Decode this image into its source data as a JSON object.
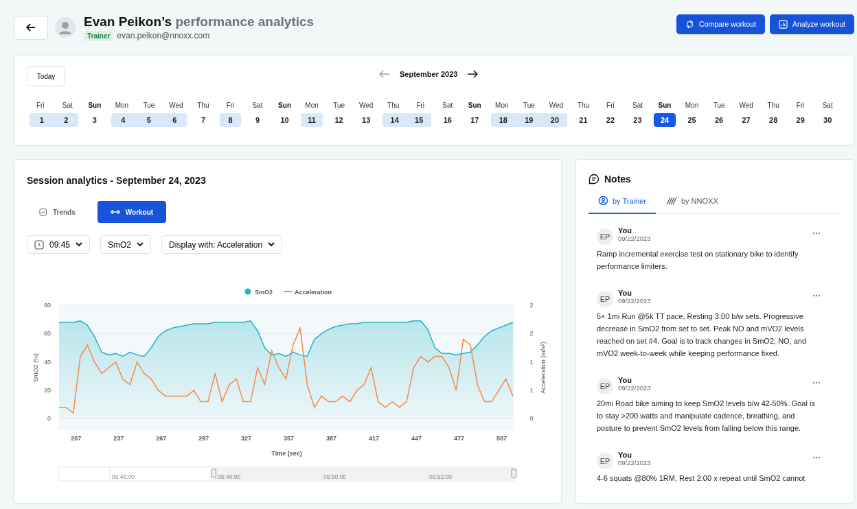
{
  "header": {
    "owner": "Evan Peikon’s",
    "title": "performance analytics",
    "role_badge": "Trainer",
    "email": "evan.peikon@nnoxx.com",
    "buttons": [
      {
        "label": "Compare workout",
        "kind": "compare"
      },
      {
        "label": "Analyze workout",
        "kind": "analyze"
      }
    ]
  },
  "calendar": {
    "today_button": "Today",
    "month": "September 2023",
    "days": [
      {
        "weekday": "Fri",
        "day": "1",
        "bold": false,
        "has_session": true,
        "selected": false
      },
      {
        "weekday": "Sat",
        "day": "2",
        "bold": false,
        "has_session": true,
        "selected": false
      },
      {
        "weekday": "Sun",
        "day": "3",
        "bold": true,
        "has_session": false,
        "selected": false
      },
      {
        "weekday": "Mon",
        "day": "4",
        "bold": false,
        "has_session": true,
        "selected": false
      },
      {
        "weekday": "Tue",
        "day": "5",
        "bold": false,
        "has_session": true,
        "selected": false
      },
      {
        "weekday": "Wed",
        "day": "6",
        "bold": false,
        "has_session": true,
        "selected": false
      },
      {
        "weekday": "Thu",
        "day": "7",
        "bold": false,
        "has_session": false,
        "selected": false
      },
      {
        "weekday": "Fri",
        "day": "8",
        "bold": false,
        "has_session": true,
        "selected": false
      },
      {
        "weekday": "Sat",
        "day": "9",
        "bold": false,
        "has_session": false,
        "selected": false
      },
      {
        "weekday": "Sun",
        "day": "10",
        "bold": true,
        "has_session": false,
        "selected": false
      },
      {
        "weekday": "Mon",
        "day": "11",
        "bold": false,
        "has_session": true,
        "selected": false
      },
      {
        "weekday": "Tue",
        "day": "12",
        "bold": false,
        "has_session": false,
        "selected": false
      },
      {
        "weekday": "Wed",
        "day": "13",
        "bold": false,
        "has_session": false,
        "selected": false
      },
      {
        "weekday": "Thu",
        "day": "14",
        "bold": false,
        "has_session": true,
        "selected": false
      },
      {
        "weekday": "Fri",
        "day": "15",
        "bold": false,
        "has_session": true,
        "selected": false
      },
      {
        "weekday": "Sat",
        "day": "16",
        "bold": false,
        "has_session": false,
        "selected": false
      },
      {
        "weekday": "Sun",
        "day": "17",
        "bold": true,
        "has_session": false,
        "selected": false
      },
      {
        "weekday": "Mon",
        "day": "18",
        "bold": false,
        "has_session": true,
        "selected": false
      },
      {
        "weekday": "Tue",
        "day": "19",
        "bold": false,
        "has_session": true,
        "selected": false
      },
      {
        "weekday": "Wed",
        "day": "20",
        "bold": false,
        "has_session": true,
        "selected": false
      },
      {
        "weekday": "Thu",
        "day": "21",
        "bold": false,
        "has_session": false,
        "selected": false
      },
      {
        "weekday": "Fri",
        "day": "22",
        "bold": false,
        "has_session": false,
        "selected": false
      },
      {
        "weekday": "Sat",
        "day": "23",
        "bold": false,
        "has_session": false,
        "selected": false
      },
      {
        "weekday": "Sun",
        "day": "24",
        "bold": true,
        "has_session": false,
        "selected": true
      },
      {
        "weekday": "Mon",
        "day": "25",
        "bold": false,
        "has_session": false,
        "selected": false
      },
      {
        "weekday": "Tue",
        "day": "26",
        "bold": false,
        "has_session": false,
        "selected": false
      },
      {
        "weekday": "Wed",
        "day": "27",
        "bold": false,
        "has_session": false,
        "selected": false
      },
      {
        "weekday": "Thu",
        "day": "28",
        "bold": false,
        "has_session": false,
        "selected": false
      },
      {
        "weekday": "Fri",
        "day": "29",
        "bold": false,
        "has_session": false,
        "selected": false
      },
      {
        "weekday": "Sat",
        "day": "30",
        "bold": false,
        "has_session": false,
        "selected": false
      }
    ]
  },
  "session": {
    "title": "Session analytics - September 24, 2023",
    "tabs": [
      {
        "label": "Trends",
        "kind": "trends",
        "selected": false
      },
      {
        "label": "Workout",
        "kind": "workout",
        "selected": true
      }
    ],
    "filters": [
      {
        "label": "09:45",
        "kind": "time"
      },
      {
        "label": "SmO2",
        "kind": "plain"
      },
      {
        "label": "Display with: Acceleration",
        "kind": "plain"
      }
    ],
    "chart_data": {
      "type": "area",
      "grid": true,
      "legend": true,
      "xlabel": "Time (sec)",
      "ylabel": "SmO2 (%)",
      "y2label": "Acceleration (m/s²)",
      "x": [
        195,
        200,
        205,
        210,
        215,
        220,
        225,
        230,
        235,
        240,
        245,
        250,
        255,
        260,
        265,
        270,
        275,
        280,
        285,
        290,
        295,
        300,
        305,
        310,
        315,
        320,
        325,
        330,
        335,
        340,
        345,
        350,
        355,
        360,
        365,
        370,
        375,
        380,
        385,
        390,
        395,
        400,
        405,
        410,
        415,
        420,
        425,
        430,
        435,
        440,
        445,
        450,
        455,
        460,
        465,
        470,
        475,
        480,
        485,
        490,
        495,
        500,
        505,
        510,
        515
      ],
      "xlim": [
        195,
        516
      ],
      "ylim": [
        -8,
        80
      ],
      "y2lim": [
        -0.2,
        2
      ],
      "xticks": [
        207,
        237,
        267,
        297,
        327,
        357,
        387,
        417,
        447,
        477,
        507
      ],
      "yticks": [
        0,
        20,
        40,
        60,
        80
      ],
      "y2ticks": [
        {
          "value": 0,
          "label": "0"
        },
        {
          "value": 0.5,
          "label": "1"
        },
        {
          "value": 1,
          "label": "1"
        },
        {
          "value": 1.5,
          "label": "2"
        },
        {
          "value": 2,
          "label": "2"
        }
      ],
      "series": [
        {
          "name": "SmO2",
          "color": "#1eb5c4",
          "values": [
            68,
            68,
            68,
            69,
            66,
            58,
            47,
            45,
            46,
            44,
            47,
            45,
            44,
            50,
            58,
            62,
            64,
            65,
            66,
            67,
            67,
            67,
            68,
            68,
            68,
            68,
            68,
            69,
            62,
            50,
            45,
            46,
            44,
            47,
            45,
            44,
            56,
            60,
            63,
            65,
            66,
            67,
            67,
            68,
            68,
            68,
            68,
            68,
            68,
            68,
            69,
            69,
            63,
            50,
            46,
            46,
            45,
            46,
            47,
            52,
            58,
            62,
            64,
            66,
            68
          ]
        },
        {
          "name": "Acceleration",
          "color": "#f5884a",
          "axis": "y2",
          "type": "line",
          "values": [
            0.2,
            0.2,
            0.1,
            1.1,
            1.3,
            1,
            0.8,
            0.9,
            1,
            0.7,
            0.6,
            1,
            0.8,
            0.7,
            0.5,
            0.4,
            0.4,
            0.4,
            0.4,
            0.5,
            0.3,
            0.3,
            0.8,
            0.3,
            0.6,
            0.7,
            0.3,
            0.3,
            0.9,
            0.6,
            1.2,
            0.9,
            0.7,
            1.3,
            1.6,
            0.6,
            0.2,
            0.4,
            0.3,
            0.3,
            0.4,
            0.3,
            0.5,
            0.6,
            0.9,
            0.3,
            0.2,
            0.3,
            0.2,
            0.3,
            0.9,
            1.1,
            1,
            1.1,
            1.1,
            0.9,
            0.5,
            1.4,
            1.3,
            0.6,
            0.3,
            0.3,
            0.5,
            0.7,
            0.4
          ]
        }
      ]
    },
    "navigator": {
      "labels": [
        "05:46:00",
        "05:48:00",
        "05:50:00",
        "05:52:00"
      ],
      "level": 0.66
    }
  },
  "notes": {
    "title": "Notes",
    "tabs": [
      {
        "label": "by Trainer",
        "kind": "trainer",
        "selected": true
      },
      {
        "label": "by NNOXX",
        "kind": "nnoxx",
        "selected": false
      }
    ],
    "items": [
      {
        "initials": "EP",
        "author": "You",
        "date": "09/22/2023",
        "text": "Ramp incremental exercise test on stationary bike to identify performance limiters."
      },
      {
        "initials": "EP",
        "author": "You",
        "date": "09/22/2023",
        "text": "5× 1mi Run @5k TT pace, Resting 3:00 b/w sets. Progressive decrease in SmO2 from set to set. Peak NO and mVO2 levels reached on set #4. Goal is to track changes in SmO2, NO, and mVO2 week-to-week while keeping performance fixed."
      },
      {
        "initials": "EP",
        "author": "You",
        "date": "09/22/2023",
        "text": "20mi Road bike aiming to keep SmO2 levels b/w 42-50%. Goal is to stay >200 watts and manipulate cadence, breathing, and posture to prevent SmO2 levels from falling below this range."
      },
      {
        "initials": "EP",
        "author": "You",
        "date": "09/22/2023",
        "text": "4-6 squats @80% 1RM, Rest 2:00 x repeat until SmO2 cannot"
      }
    ]
  }
}
